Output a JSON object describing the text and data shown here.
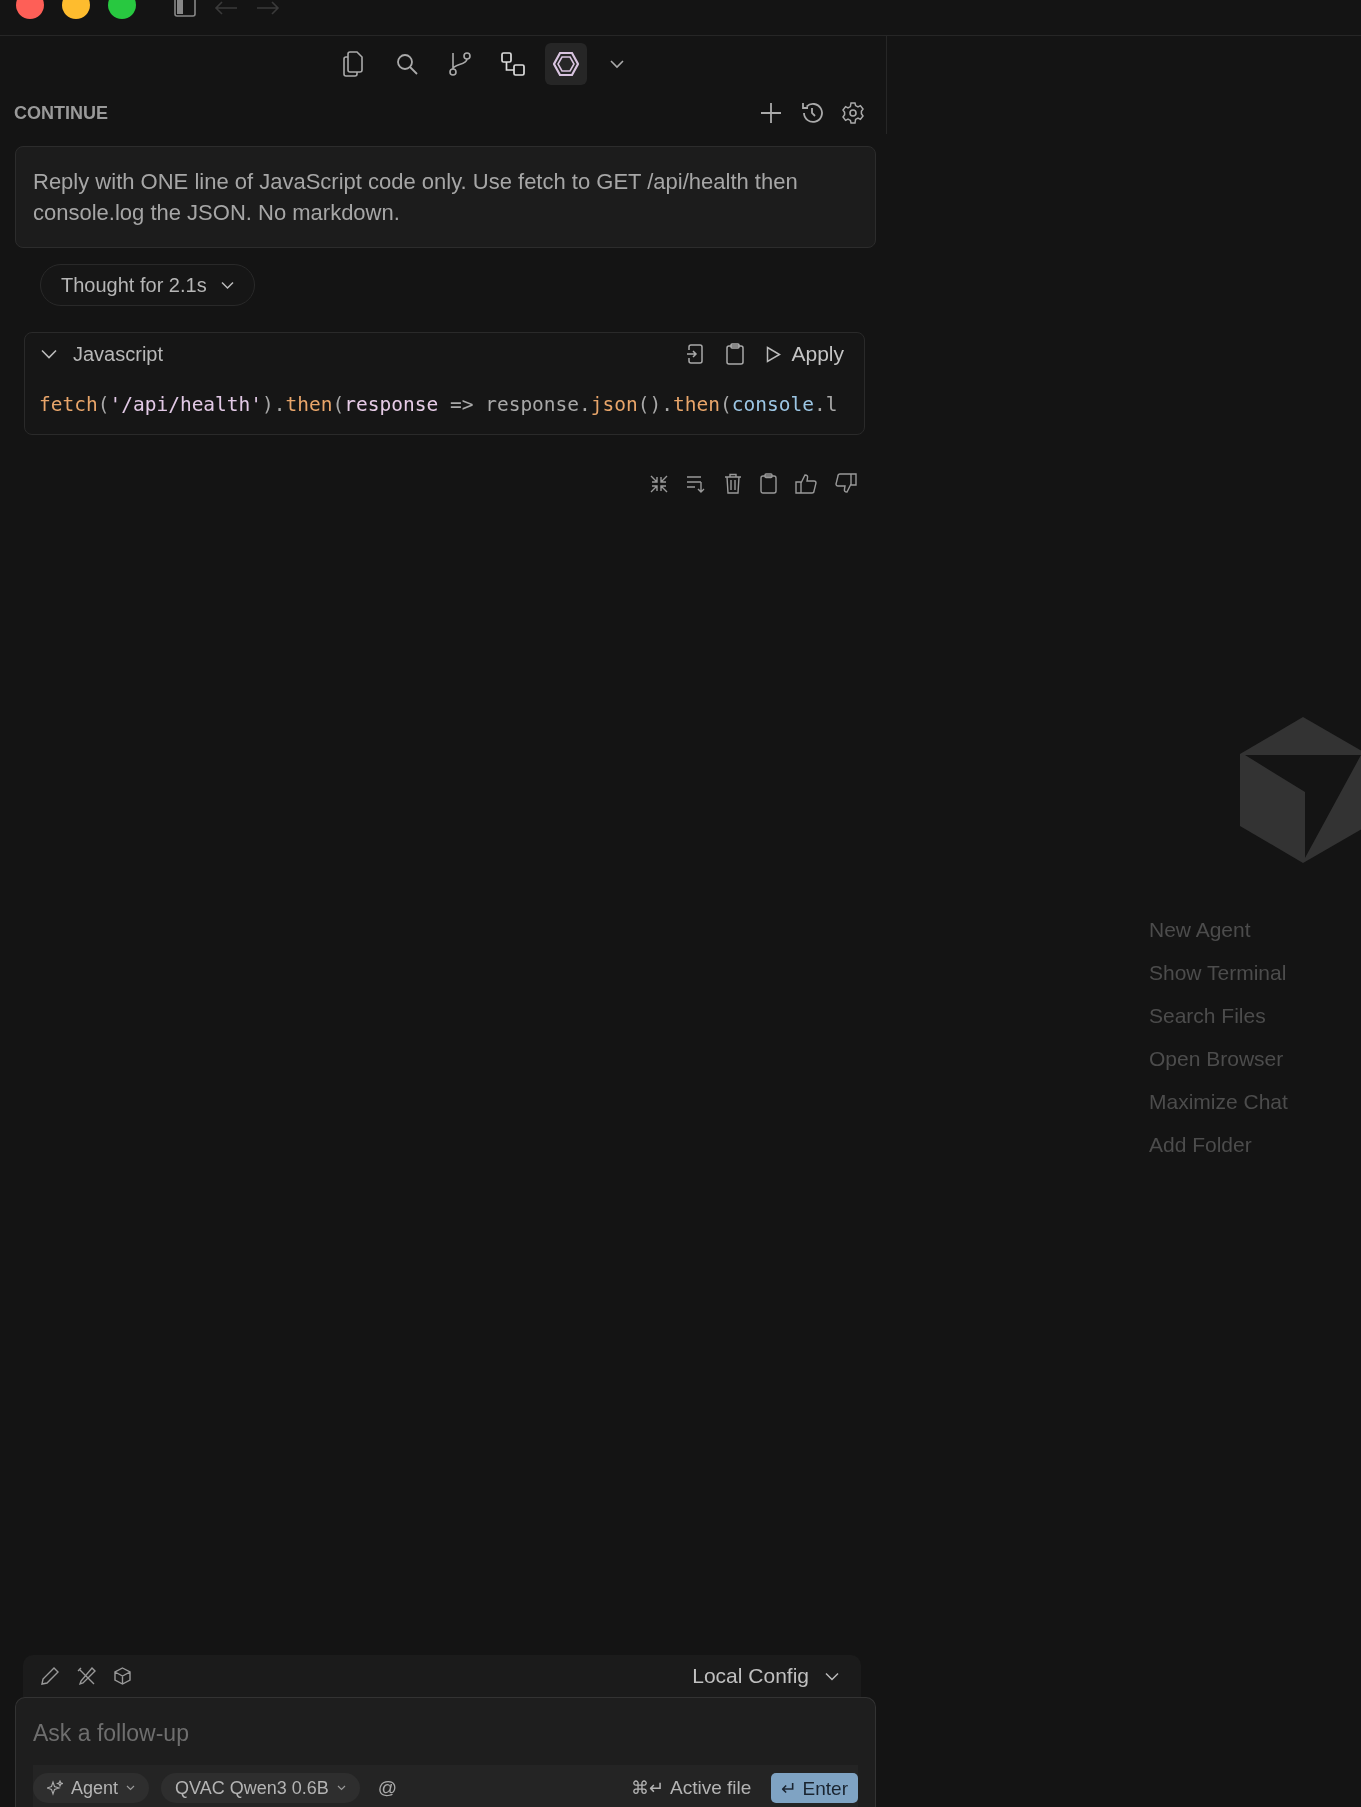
{
  "view_tabs": [
    {
      "kind": "files",
      "selected": false
    },
    {
      "kind": "search",
      "selected": false
    },
    {
      "kind": "branch",
      "selected": false
    },
    {
      "kind": "blocks",
      "selected": false
    },
    {
      "kind": "continue",
      "selected": true
    }
  ],
  "panel": {
    "title": "CONTINUE"
  },
  "user_message": "Reply with ONE line of JavaScript code only. Use fetch to GET /api/health then console.log the JSON. No markdown.",
  "thought": {
    "label": "Thought for 2.1s",
    "expanded": false
  },
  "code_block": {
    "language": "Javascript",
    "expanded": true,
    "apply_label": "Apply",
    "tokens": [
      {
        "text": "fetch",
        "kind": "fn"
      },
      {
        "text": "(",
        "kind": "punct"
      },
      {
        "text": "'/api/health'",
        "kind": "str"
      },
      {
        "text": ").",
        "kind": "punct"
      },
      {
        "text": "then",
        "kind": "fn"
      },
      {
        "text": "(",
        "kind": "punct"
      },
      {
        "text": "response",
        "kind": "param"
      },
      {
        "text": " => response.",
        "kind": "plain"
      },
      {
        "text": "json",
        "kind": "fn"
      },
      {
        "text": "().",
        "kind": "punct"
      },
      {
        "text": "then",
        "kind": "fn"
      },
      {
        "text": "(",
        "kind": "punct"
      },
      {
        "text": "console",
        "kind": "builtin"
      },
      {
        "text": ".l",
        "kind": "plain"
      }
    ]
  },
  "shortcuts": [
    "New Agent",
    "Show Terminal",
    "Search Files",
    "Open Browser",
    "Maximize Chat",
    "Add Folder"
  ],
  "composer": {
    "config": "Local Config",
    "placeholder": "Ask a follow-up",
    "mode": "Agent",
    "model": "QVAC Qwen3 0.6B",
    "mention": "@",
    "shortcut_keys": "⌘↵",
    "shortcut_label": "Active file",
    "submit_label": "↵ Enter"
  }
}
